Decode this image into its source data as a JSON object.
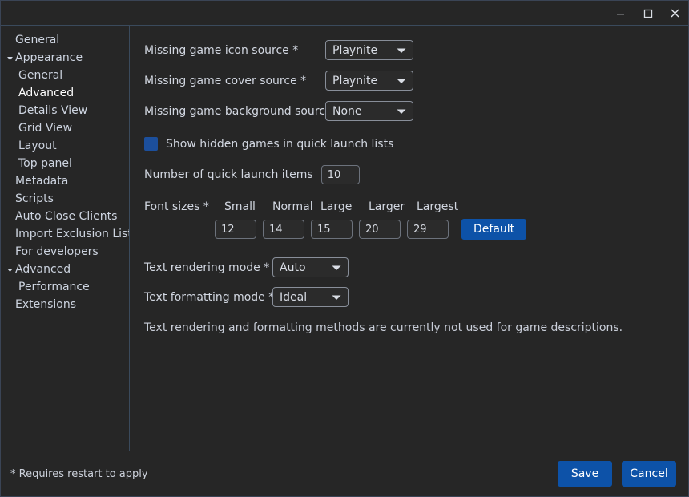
{
  "window": {
    "title": "",
    "controls": {
      "minimize": "minimize-icon",
      "maximize": "maximize-icon",
      "close": "close-icon"
    }
  },
  "sidebar": {
    "items": [
      {
        "label": "General",
        "level": 0,
        "expander": "none",
        "selected": false
      },
      {
        "label": "Appearance",
        "level": 0,
        "expander": "expanded",
        "selected": false
      },
      {
        "label": "General",
        "level": 1,
        "expander": "none",
        "selected": false
      },
      {
        "label": "Advanced",
        "level": 1,
        "expander": "none",
        "selected": true
      },
      {
        "label": "Details View",
        "level": 1,
        "expander": "none",
        "selected": false
      },
      {
        "label": "Grid View",
        "level": 1,
        "expander": "none",
        "selected": false
      },
      {
        "label": "Layout",
        "level": 1,
        "expander": "none",
        "selected": false
      },
      {
        "label": "Top panel",
        "level": 1,
        "expander": "none",
        "selected": false
      },
      {
        "label": "Metadata",
        "level": 0,
        "expander": "none",
        "selected": false
      },
      {
        "label": "Scripts",
        "level": 0,
        "expander": "none",
        "selected": false
      },
      {
        "label": "Auto Close Clients",
        "level": 0,
        "expander": "none",
        "selected": false
      },
      {
        "label": "Import Exclusion List",
        "level": 0,
        "expander": "none",
        "selected": false
      },
      {
        "label": "For developers",
        "level": 0,
        "expander": "none",
        "selected": false
      },
      {
        "label": "Advanced",
        "level": 0,
        "expander": "expanded",
        "selected": false
      },
      {
        "label": "Performance",
        "level": 1,
        "expander": "none",
        "selected": false
      },
      {
        "label": "Extensions",
        "level": 0,
        "expander": "none",
        "selected": false
      }
    ]
  },
  "main": {
    "missing_icon": {
      "label": "Missing game icon source *",
      "value": "Playnite"
    },
    "missing_cover": {
      "label": "Missing game cover source *",
      "value": "Playnite"
    },
    "missing_background": {
      "label": "Missing game background source *",
      "value": "None"
    },
    "show_hidden": {
      "label": "Show hidden games in quick launch lists",
      "checked": true
    },
    "quick_launch_items": {
      "label": "Number of quick launch items",
      "value": "10"
    },
    "font_sizes": {
      "label": "Font sizes *",
      "columns": [
        "Small",
        "Normal",
        "Large",
        "Larger",
        "Largest"
      ],
      "values": [
        "12",
        "14",
        "15",
        "20",
        "29"
      ],
      "default_button": "Default"
    },
    "text_rendering": {
      "label": "Text rendering mode *",
      "value": "Auto"
    },
    "text_formatting": {
      "label": "Text formatting mode *",
      "value": "Ideal"
    },
    "note": "Text rendering and formatting methods are currently not used for game descriptions."
  },
  "footer": {
    "note": "* Requires restart to apply",
    "save_label": "Save",
    "cancel_label": "Cancel"
  },
  "colors": {
    "accent": "#0d52a8",
    "background": "#262626",
    "text": "#d2d7e1",
    "divider": "#3a4a5c",
    "checkbox_fill": "#1c4f9c"
  }
}
